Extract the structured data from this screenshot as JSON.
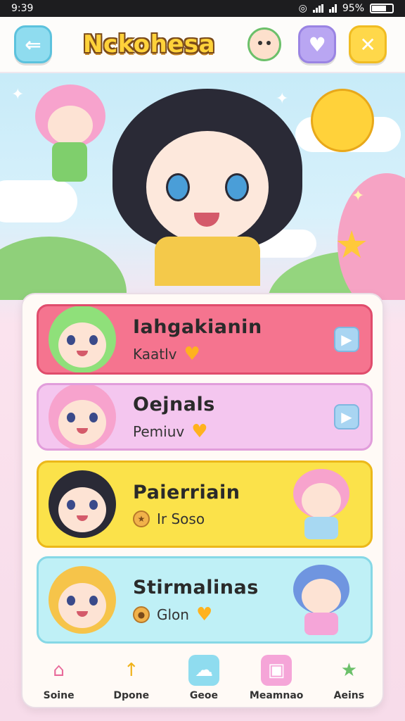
{
  "status_bar": {
    "time": "9:39",
    "battery": "95%"
  },
  "header": {
    "title": "Nckohesa"
  },
  "cards": [
    {
      "name": "Iahgakianin",
      "sub": "Kaatlv",
      "accent": "#f5748f"
    },
    {
      "name": "Oejnals",
      "sub": "Pemiuv",
      "accent": "#f4c6ef"
    },
    {
      "name": "Paierriain",
      "sub": "Ir Soso",
      "accent": "#fbe24a"
    },
    {
      "name": "Stirmalinas",
      "sub": "Glon",
      "accent": "#bff0f6"
    }
  ],
  "nav": [
    {
      "label": "Soine",
      "icon": "house-icon"
    },
    {
      "label": "Dpone",
      "icon": "up-arrow-icon"
    },
    {
      "label": "Geoe",
      "icon": "ghost-icon"
    },
    {
      "label": "Meamnao",
      "icon": "picture-icon"
    },
    {
      "label": "Aeins",
      "icon": "star-arrow-icon"
    }
  ]
}
